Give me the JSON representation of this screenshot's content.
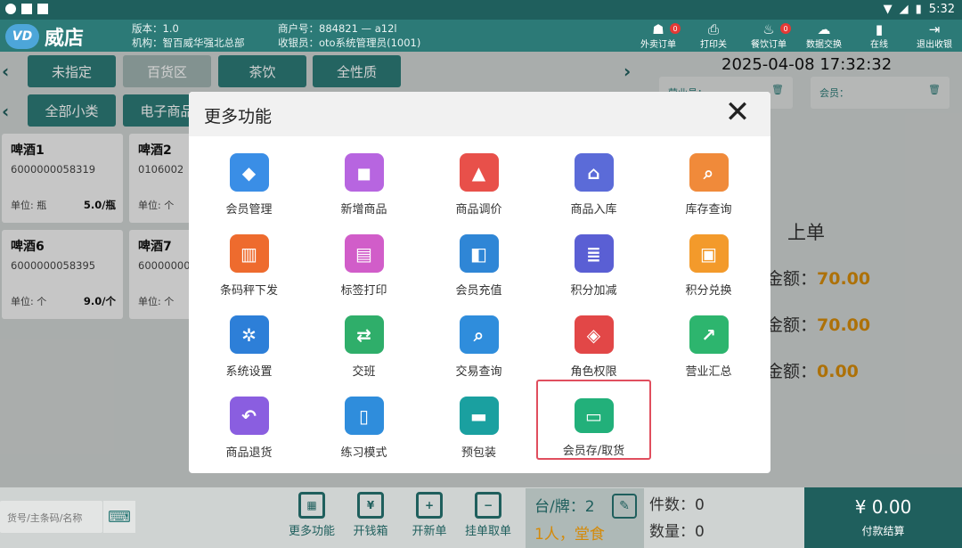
{
  "statusbar": {
    "time": "5:32"
  },
  "header": {
    "logo_badge": "VD",
    "brand": "威店",
    "version": "版本：1.0",
    "org": "机构：智百威华强北总部",
    "merchant": "商户号：884821 — a12l",
    "cashier": "收银员：oto系统管理员(1001)",
    "buttons": [
      {
        "label": "外卖订单",
        "icon": "takeout-icon",
        "badge": "0"
      },
      {
        "label": "打印关",
        "icon": "printer-off-icon"
      },
      {
        "label": "餐饮订单",
        "icon": "dining-icon",
        "badge": "0"
      },
      {
        "label": "数据交换",
        "icon": "cloud-sync-icon"
      },
      {
        "label": "在线",
        "icon": "signal-icon"
      },
      {
        "label": "退出收银",
        "icon": "logout-icon"
      }
    ]
  },
  "categories_row1": [
    "未指定",
    "百货区",
    "茶饮",
    "全性质"
  ],
  "categories_row2": [
    "全部小类",
    "电子商品"
  ],
  "products": [
    {
      "name": "啤酒1",
      "code": "6000000058319",
      "unit": "单位: 瓶",
      "price": "5.0/瓶"
    },
    {
      "name": "啤酒2",
      "code": "0106002",
      "unit": "单位: 个",
      "price": ""
    },
    {
      "name": "啤酒6",
      "code": "6000000058395",
      "unit": "单位: 个",
      "price": "9.0/个"
    },
    {
      "name": "啤酒7",
      "code": "60000000",
      "unit": "单位: 个",
      "price": ""
    }
  ],
  "right": {
    "datetime": "2025-04-08 17:32:32",
    "salesman": "营业员：",
    "member": "会员：",
    "order_title": "上单",
    "amounts": [
      {
        "label": "金额：",
        "value": "70.00"
      },
      {
        "label": "金额：",
        "value": "70.00"
      },
      {
        "label": "金额：",
        "value": "0.00"
      }
    ]
  },
  "bottom": {
    "search_placeholder": "货号/主条码/名称",
    "actions": [
      "更多功能",
      "开钱箱",
      "开新单",
      "挂单取单"
    ],
    "table_label": "台/牌：2",
    "table_sub": "1人，堂食",
    "qty_label": "件数：0",
    "count_label": "数量：0",
    "pay_amount": "¥ 0.00",
    "pay_label": "付款结算"
  },
  "modal": {
    "title": "更多功能",
    "items": [
      {
        "label": "会员管理",
        "icon": "diamond-icon",
        "color": "#3a8ee6"
      },
      {
        "label": "新增商品",
        "icon": "shopping-bag-icon",
        "color": "#b765e0"
      },
      {
        "label": "商品调价",
        "icon": "price-chart-icon",
        "color": "#e8504a"
      },
      {
        "label": "商品入库",
        "icon": "warehouse-in-icon",
        "color": "#5b6bd8"
      },
      {
        "label": "库存查询",
        "icon": "inventory-search-icon",
        "color": "#f08a3a"
      },
      {
        "label": "条码秤下发",
        "icon": "barcode-icon",
        "color": "#ee6b2e"
      },
      {
        "label": "标签打印",
        "icon": "label-print-icon",
        "color": "#d15dc9"
      },
      {
        "label": "会员充值",
        "icon": "wallet-icon",
        "color": "#2f86d6"
      },
      {
        "label": "积分加减",
        "icon": "coin-stack-icon",
        "color": "#5a5fd4"
      },
      {
        "label": "积分兑换",
        "icon": "gift-icon",
        "color": "#f39a2b"
      },
      {
        "label": "系统设置",
        "icon": "gear-icon",
        "color": "#2d7fd8"
      },
      {
        "label": "交班",
        "icon": "shift-change-icon",
        "color": "#2fae6a"
      },
      {
        "label": "交易查询",
        "icon": "transaction-search-icon",
        "color": "#2f8ddc"
      },
      {
        "label": "角色权限",
        "icon": "user-lock-icon",
        "color": "#e24747"
      },
      {
        "label": "营业汇总",
        "icon": "trend-chart-icon",
        "color": "#2db56e"
      },
      {
        "label": "商品退货",
        "icon": "return-icon",
        "color": "#8a5ee0"
      },
      {
        "label": "练习模式",
        "icon": "book-icon",
        "color": "#2f8ddc"
      },
      {
        "label": "预包装",
        "icon": "prepack-icon",
        "color": "#1aa0a0"
      },
      {
        "label": "会员存/取货",
        "icon": "member-storage-icon",
        "color": "#22b07a"
      }
    ]
  }
}
